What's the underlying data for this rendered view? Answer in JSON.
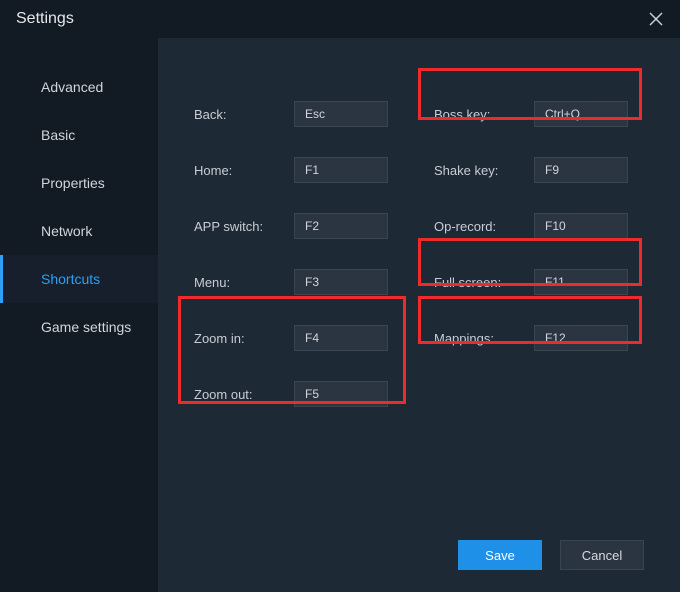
{
  "window": {
    "title": "Settings"
  },
  "sidebar": {
    "items": [
      {
        "label": "Advanced"
      },
      {
        "label": "Basic"
      },
      {
        "label": "Properties"
      },
      {
        "label": "Network"
      },
      {
        "label": "Shortcuts"
      },
      {
        "label": "Game settings"
      }
    ],
    "activeIndex": 4
  },
  "shortcuts": {
    "left": [
      {
        "label": "Back:",
        "value": "Esc"
      },
      {
        "label": "Home:",
        "value": "F1"
      },
      {
        "label": "APP switch:",
        "value": "F2"
      },
      {
        "label": "Menu:",
        "value": "F3"
      },
      {
        "label": "Zoom in:",
        "value": "F4"
      },
      {
        "label": "Zoom out:",
        "value": "F5"
      }
    ],
    "right": [
      {
        "label": "Boss key:",
        "value": "Ctrl+Q"
      },
      {
        "label": "Shake key:",
        "value": "F9"
      },
      {
        "label": "Op-record:",
        "value": "F10"
      },
      {
        "label": "Full screen:",
        "value": "F11"
      },
      {
        "label": "Mappings:",
        "value": "F12"
      }
    ]
  },
  "footer": {
    "save": "Save",
    "cancel": "Cancel"
  }
}
